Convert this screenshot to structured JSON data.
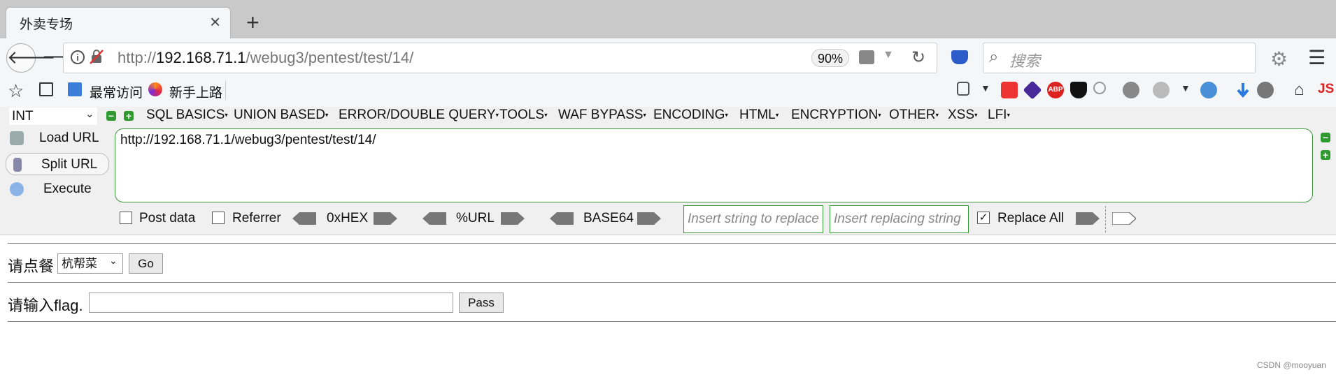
{
  "browser": {
    "tab_title": "外卖专场",
    "url_prefix": "http://",
    "url_host": "192.168.71.1",
    "url_path": "/webug3/pentest/test/14/",
    "zoom": "90%",
    "search_placeholder": "搜索"
  },
  "bookmarks": [
    {
      "label": "最常访问",
      "icon": "bookmark-folder-icon"
    },
    {
      "label": "新手上路",
      "icon": "firefox-icon"
    }
  ],
  "extensions": [
    "tab-icon",
    "pi-icon",
    "diamond-icon",
    "abp-icon",
    "shield-w-icon",
    "search-ext-icon",
    "layers-icon",
    "palette-icon",
    "globe-icon",
    "download-icon",
    "globe2-icon",
    "home-icon"
  ],
  "extensions_js_label": "JS",
  "hackbar": {
    "encoding_select": "INT",
    "menus": [
      "SQL BASICS",
      "UNION BASED",
      "ERROR/DOUBLE QUERY",
      "TOOLS",
      "WAF BYPASS",
      "ENCODING",
      "HTML",
      "ENCRYPTION",
      "OTHER",
      "XSS",
      "LFI"
    ],
    "load_url": "Load URL",
    "split_url": "Split URL",
    "execute": "Execute",
    "url_value": "http://192.168.71.1/webug3/pentest/test/14/",
    "post_data": "Post data",
    "referrer": "Referrer",
    "hex": "0xHEX",
    "url_enc": "%URL",
    "base64": "BASE64",
    "replace_placeholder": "Insert string to replace",
    "replacing_placeholder": "Insert replacing string",
    "replace_all": "Replace All",
    "replace_all_checked": true
  },
  "page": {
    "order_label": "请点餐",
    "dish_selected": "杭帮菜",
    "go_button": "Go",
    "flag_label": "请输入flag.",
    "flag_value": "",
    "pass_button": "Pass"
  },
  "watermark": "CSDN @mooyuan",
  "colors": {
    "hackbar_green": "#3a9a3a",
    "toolbar_bg": "#f5f6f7",
    "tabstrip_bg": "#c9c9c9"
  }
}
